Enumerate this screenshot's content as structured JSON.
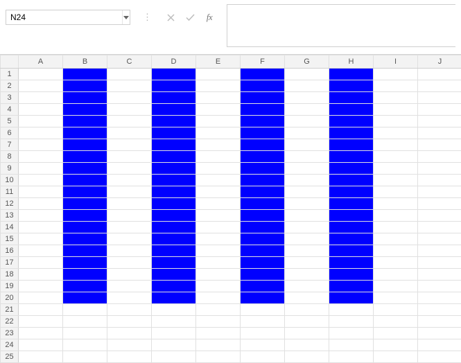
{
  "nameBox": {
    "value": "N24"
  },
  "formulaBar": {
    "separator": "⋮",
    "cancelEnabled": false,
    "enterEnabled": false,
    "fx": "fx",
    "value": ""
  },
  "columns": [
    "A",
    "B",
    "C",
    "D",
    "E",
    "F",
    "G",
    "H",
    "I",
    "J"
  ],
  "rowCount": 25,
  "filledColumns": [
    "B",
    "D",
    "F",
    "H"
  ],
  "filledRowStart": 1,
  "filledRowEnd": 20,
  "fillColor": "#0000ff"
}
